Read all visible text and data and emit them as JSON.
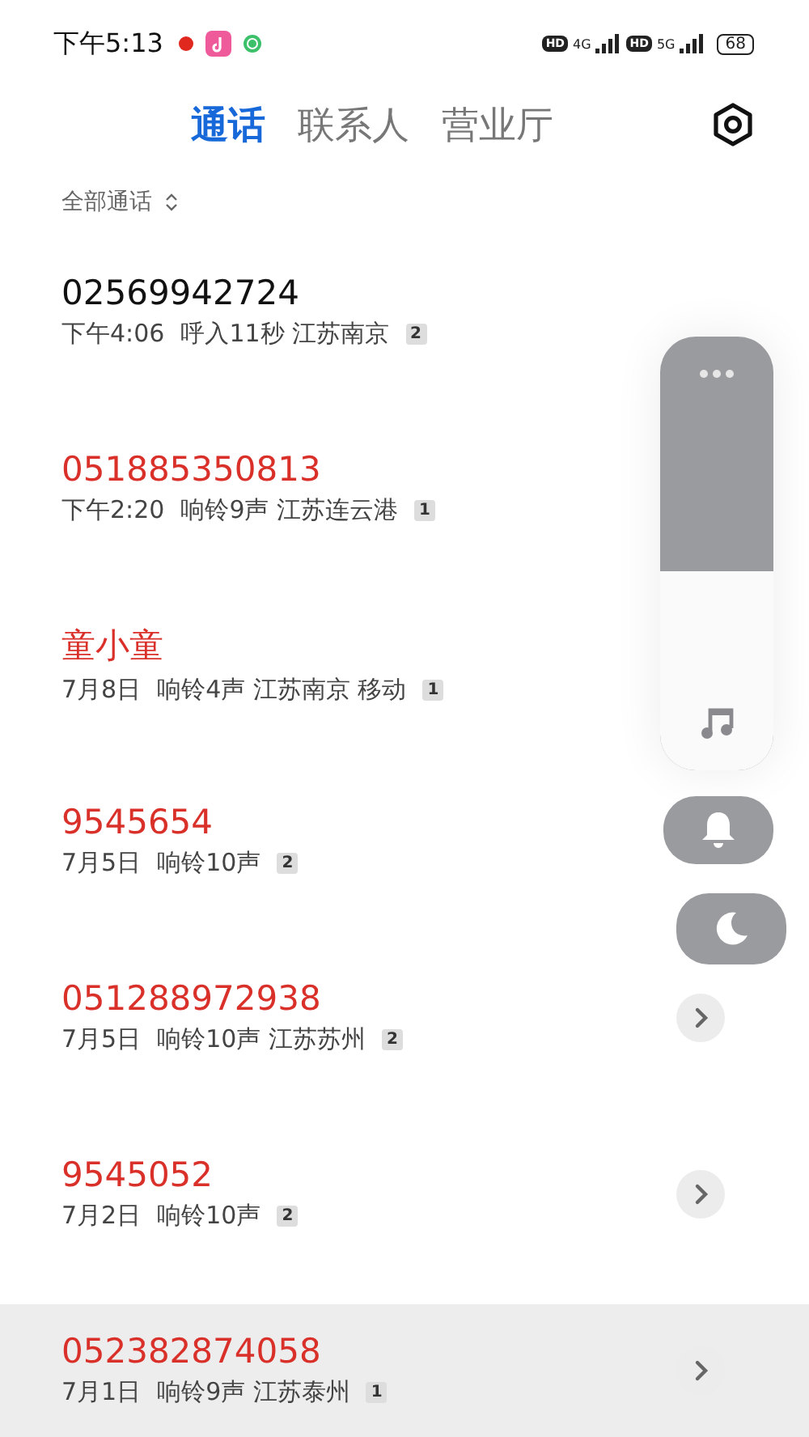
{
  "status_bar": {
    "time": "下午5:13",
    "sim1": {
      "hd": "HD",
      "network": "4G"
    },
    "sim2": {
      "hd": "HD",
      "network": "5G"
    },
    "battery": "68"
  },
  "tabs": [
    {
      "label": "通话",
      "selected": true
    },
    {
      "label": "联系人",
      "selected": false
    },
    {
      "label": "营业厅",
      "selected": false
    }
  ],
  "filter": {
    "label": "全部通话"
  },
  "calls": [
    {
      "name": "02569942724",
      "missed": false,
      "time": "下午4:06",
      "info": "呼入11秒 江苏南京",
      "count": "2",
      "more_button": false,
      "selected": false
    },
    {
      "name": "051885350813",
      "missed": true,
      "time": "下午2:20",
      "info": "响铃9声 江苏连云港",
      "count": "1",
      "more_button": false,
      "selected": false
    },
    {
      "name": "童小童",
      "missed": true,
      "time": "7月8日",
      "info": "响铃4声 江苏南京 移动",
      "count": "1",
      "more_button": false,
      "selected": false
    },
    {
      "name": "9545654",
      "missed": true,
      "time": "7月5日",
      "info": "响铃10声",
      "count": "2",
      "more_button": false,
      "selected": false
    },
    {
      "name": "051288972938",
      "missed": true,
      "time": "7月5日",
      "info": "响铃10声 江苏苏州",
      "count": "2",
      "more_button": true,
      "selected": false
    },
    {
      "name": "9545052",
      "missed": true,
      "time": "7月2日",
      "info": "响铃10声",
      "count": "2",
      "more_button": true,
      "selected": false
    },
    {
      "name": "052382874058",
      "missed": true,
      "time": "7月1日",
      "info": "响铃9声 江苏泰州",
      "count": "1",
      "more_button": true,
      "selected": true
    }
  ],
  "volume": {
    "level": 0.46
  }
}
